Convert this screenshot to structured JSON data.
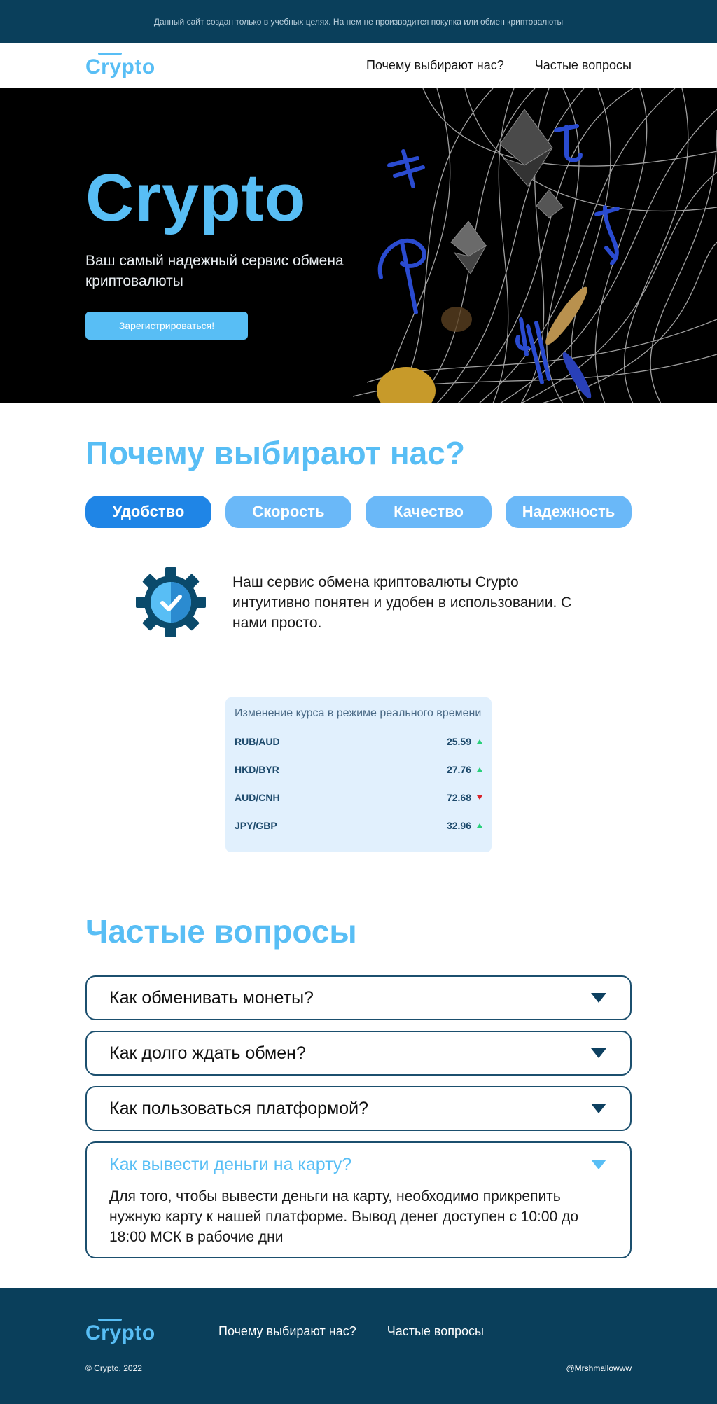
{
  "notice": "Данный сайт создан только в учебных целях. На нем не производится покупка или обмен криптовалюты",
  "header": {
    "logo": "Crypto",
    "nav": [
      "Почему выбирают нас?",
      "Частые вопросы"
    ]
  },
  "hero": {
    "title": "Crypto",
    "subtitle": "Ваш самый надежный сервис обмена криптовалюты",
    "button": "Зарегистрироваться!"
  },
  "why": {
    "title": "Почему выбирают нас?",
    "tabs": [
      "Удобство",
      "Скорость",
      "Качество",
      "Надежность"
    ],
    "active_tab": "Удобство",
    "feature_icon": "gear-check-icon",
    "feature_text": "Наш сервис обмена криптовалюты Crypto интуитивно понятен и удобен в использовании. С нами просто."
  },
  "rates": {
    "title": "Изменение курса в режиме реального времени",
    "rows": [
      {
        "pair": "RUB/AUD",
        "value": "25.59",
        "trend": "up"
      },
      {
        "pair": "HKD/BYR",
        "value": "27.76",
        "trend": "up"
      },
      {
        "pair": "AUD/CNH",
        "value": "72.68",
        "trend": "down"
      },
      {
        "pair": "JPY/GBP",
        "value": "32.96",
        "trend": "up"
      }
    ]
  },
  "faq": {
    "title": "Частые вопросы",
    "items": [
      {
        "q": "Как обменивать монеты?",
        "open": false
      },
      {
        "q": "Как долго ждать обмен?",
        "open": false
      },
      {
        "q": "Как пользоваться платформой?",
        "open": false
      },
      {
        "q": "Как вывести деньги на карту?",
        "open": true,
        "a": "Для того, чтобы вывести деньги на карту, необходимо прикрепить нужную карту к нашей платформе. Вывод денег доступен с 10:00 до 18:00 МСК в рабочие дни"
      }
    ]
  },
  "footer": {
    "logo": "Crypto",
    "nav": [
      "Почему выбирают нас?",
      "Частые вопросы"
    ],
    "copyright": "© Crypto, 2022",
    "handle": "@Mrshmallowww"
  },
  "colors": {
    "accent": "#58bef5",
    "dark": "#0a3f5b",
    "tab_active": "#1f85e6",
    "tab": "#6ab8f8",
    "up": "#28d07a",
    "down": "#d8232a"
  }
}
